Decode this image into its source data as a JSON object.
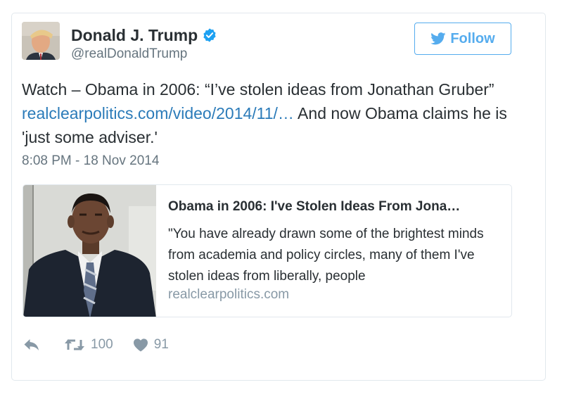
{
  "tweet": {
    "author": {
      "name": "Donald J. Trump",
      "handle": "@realDonaldTrump",
      "verified": true
    },
    "follow_label": "Follow",
    "text_before_link": "Watch – Obama in 2006: “I’ve stolen ideas from Jonathan Gruber” ",
    "link_text": "realclearpolitics.com/video/2014/11/…",
    "text_after_link": " And now Obama claims he is 'just some adviser.'",
    "timestamp": "8:08 PM - 18 Nov 2014",
    "card": {
      "title": "Obama in 2006: I've Stolen Ideas From Jona…",
      "description": "\"You have already drawn some of the brightest minds from academia and policy circles, many of them I've stolen ideas from liberally, people",
      "domain": "realclearpolitics.com"
    },
    "actions": {
      "retweets": "100",
      "likes": "91"
    }
  },
  "colors": {
    "accent": "#55acee",
    "link": "#2b7bb9",
    "muted": "#8899a6",
    "verified": "#1da1f2"
  },
  "icons": [
    "verified-badge-icon",
    "twitter-bird-icon",
    "reply-icon",
    "retweet-icon",
    "heart-icon"
  ]
}
